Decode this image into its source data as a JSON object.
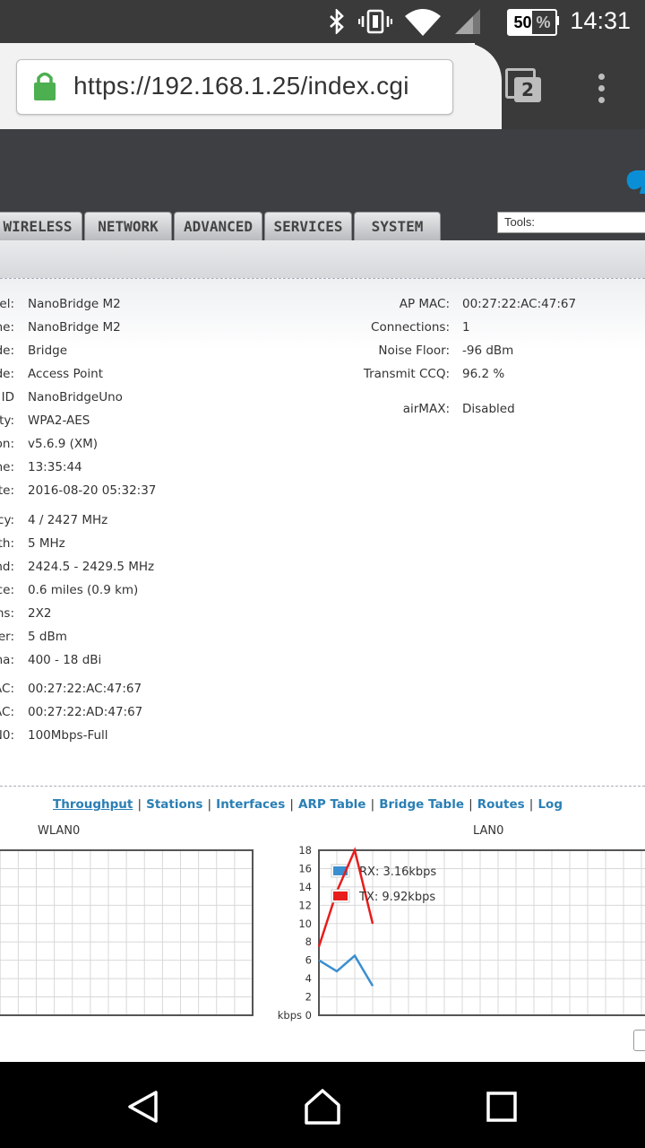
{
  "status_bar": {
    "battery": "50 %",
    "battery_level": 0.5,
    "time": "14:31",
    "icons": [
      "bluetooth-icon",
      "vibrate-icon",
      "wifi-icon",
      "cell-signal-icon",
      "battery-icon"
    ]
  },
  "browser": {
    "url": "https://192.168.1.25/index.cgi",
    "tab_count": "2"
  },
  "nav_tabs": [
    "WIRELESS",
    "NETWORK",
    "ADVANCED",
    "SERVICES",
    "SYSTEM"
  ],
  "tools_select": "Tools:",
  "info_left": [
    {
      "label": "el:",
      "value": "NanoBridge M2"
    },
    {
      "label": "ne:",
      "value": "NanoBridge M2"
    },
    {
      "label": "de:",
      "value": "Bridge"
    },
    {
      "label": "de:",
      "value": "Access Point"
    },
    {
      "label": "ID",
      "value": "NanoBridgeUno"
    },
    {
      "label": "ty:",
      "value": "WPA2-AES"
    },
    {
      "label": "on:",
      "value": "v5.6.9 (XM)"
    },
    {
      "label": "ne:",
      "value": "13:35:44"
    },
    {
      "label": "te:",
      "value": "2016-08-20 05:32:37"
    },
    {
      "label": "cy:",
      "value": "4 / 2427 MHz"
    },
    {
      "label": "th:",
      "value": "5 MHz"
    },
    {
      "label": "nd:",
      "value": "2424.5 - 2429.5 MHz"
    },
    {
      "label": "ce:",
      "value": "0.6 miles (0.9 km)"
    },
    {
      "label": "ns:",
      "value": "2X2"
    },
    {
      "label": "er:",
      "value": "5 dBm"
    },
    {
      "label": "na:",
      "value": "400 - 18 dBi"
    },
    {
      "label": "AC:",
      "value": "00:27:22:AC:47:67"
    },
    {
      "label": "AC:",
      "value": "00:27:22:AD:47:67"
    },
    {
      "label": "N0:",
      "value": "100Mbps-Full"
    }
  ],
  "info_right": [
    {
      "label": "AP MAC:",
      "value": "00:27:22:AC:47:67"
    },
    {
      "label": "Connections:",
      "value": "1"
    },
    {
      "label": "Noise Floor:",
      "value": "-96 dBm"
    },
    {
      "label": "Transmit CCQ:",
      "value": "96.2 %"
    },
    {
      "label": "airMAX:",
      "value": "Disabled"
    }
  ],
  "links": [
    "Throughput",
    "Stations",
    "Interfaces",
    "ARP Table",
    "Bridge Table",
    "Routes",
    "Log"
  ],
  "chart_data": [
    {
      "type": "line",
      "title": "WLAN0",
      "series": []
    },
    {
      "type": "line",
      "title": "LAN0",
      "ylabel": "kbps",
      "ylim": [
        0,
        18
      ],
      "yticks": [
        0,
        2,
        4,
        6,
        8,
        10,
        12,
        14,
        16,
        18
      ],
      "series": [
        {
          "name": "RX: 3.16kbps",
          "color": "#3a8fd0",
          "values": [
            6,
            4.8,
            6.5,
            3.2
          ]
        },
        {
          "name": "TX: 9.92kbps",
          "color": "#e81c1c",
          "values": [
            7.5,
            13.5,
            18,
            10
          ]
        }
      ]
    }
  ]
}
